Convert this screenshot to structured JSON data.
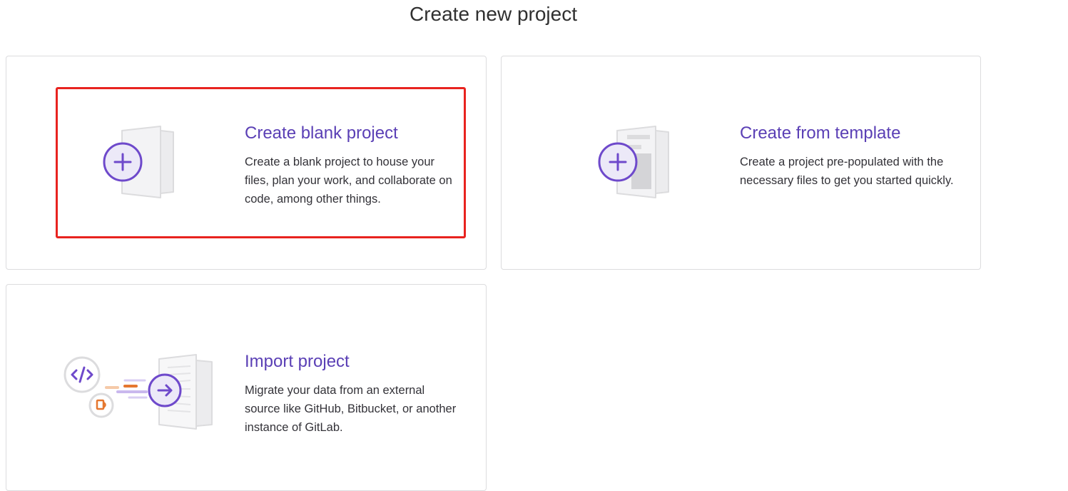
{
  "page": {
    "title": "Create new project"
  },
  "cards": [
    {
      "title": "Create blank project",
      "description": "Create a blank project to house your files, plan your work, and collaborate on code, among other things.",
      "icon": "blank-project-illustration"
    },
    {
      "title": "Create from template",
      "description": "Create a project pre-populated with the necessary files to get you started quickly.",
      "icon": "template-project-illustration"
    },
    {
      "title": "Import project",
      "description": "Migrate your data from an external source like GitHub, Bitbucket, or another instance of GitLab.",
      "icon": "import-project-illustration"
    }
  ],
  "colors": {
    "accent": "#5a3fb5",
    "highlight": "#e8231f",
    "border": "#dcdcde",
    "orange": "#e5772f"
  }
}
